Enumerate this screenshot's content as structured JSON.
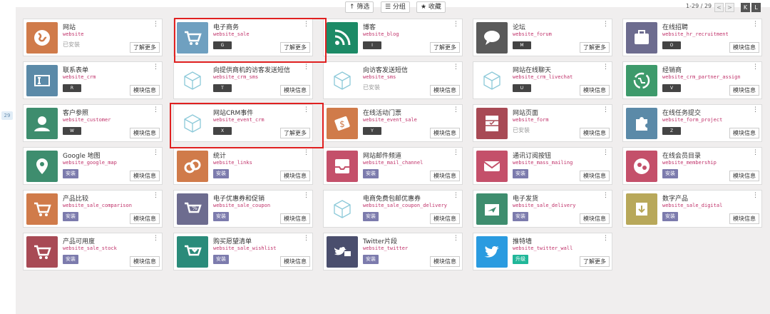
{
  "toolbar": {
    "filter_label": "↑ 筛选",
    "group_label": "☰ 分组",
    "fav_label": "★ 收藏",
    "pager": "1-29 / 29",
    "prev": "<",
    "next": ">"
  },
  "sidebar": {
    "count_badge": "29"
  },
  "cards": [
    {
      "title": "网站",
      "tech": "website",
      "status": "已安装",
      "action": "了解更多",
      "color": "#d07b4a",
      "icon": "globe-icon"
    },
    {
      "title": "电子商务",
      "tech": "website_sale",
      "key": "G",
      "action": "了解更多",
      "color": "#6fa0c0",
      "icon": "cart-icon"
    },
    {
      "title": "博客",
      "tech": "website_blog",
      "key": "I",
      "action": "了解更多",
      "color": "#1c8a66",
      "icon": "rss-icon"
    },
    {
      "title": "论坛",
      "tech": "website_forum",
      "key": "M",
      "action": "了解更多",
      "color": "#5a5a5a",
      "icon": "chat-icon"
    },
    {
      "title": "在线招聘",
      "tech": "website_hr_recruitment",
      "key": "O",
      "action": "模块信息",
      "color": "#6d6c8f",
      "icon": "briefcase-icon"
    },
    {
      "title": "联系表单",
      "tech": "website_crm",
      "key": "R",
      "action": "模块信息",
      "color": "#5b8aa8",
      "icon": "form-icon"
    },
    {
      "title": "向提供商机的访客发送短信",
      "tech": "website_crm_sms",
      "key": "T",
      "action": "模块信息",
      "color": "",
      "icon": "cube-icon"
    },
    {
      "title": "向访客发送短信",
      "tech": "website_sms",
      "status": "已安装",
      "action": "模块信息",
      "color": "",
      "icon": "cube-icon"
    },
    {
      "title": "网站在线聊天",
      "tech": "website_crm_livechat",
      "key": "U",
      "action": "模块信息",
      "color": "",
      "icon": "cube-icon"
    },
    {
      "title": "经销商",
      "tech": "website_crm_partner_assign",
      "key": "V",
      "action": "模块信息",
      "color": "#3d9a6b",
      "icon": "recycle-icon"
    },
    {
      "title": "客户参照",
      "tech": "website_customer",
      "key": "W",
      "action": "模块信息",
      "color": "#3e8d6e",
      "icon": "user-icon"
    },
    {
      "title": "网站CRM事件",
      "tech": "website_event_crm",
      "key": "X",
      "action": "了解更多",
      "color": "",
      "icon": "cube-icon"
    },
    {
      "title": "在线活动门票",
      "tech": "website_event_sale",
      "key": "Y",
      "action": "模块信息",
      "color": "#d07b4a",
      "icon": "ticket-icon"
    },
    {
      "title": "网站页面",
      "tech": "website_form",
      "status": "已安装",
      "action": "模块信息",
      "color": "#a84a55",
      "icon": "cabinet-icon"
    },
    {
      "title": "在线任务提交",
      "tech": "website_form_project",
      "key": "Z",
      "action": "模块信息",
      "color": "#5b8aa8",
      "icon": "puzzle-icon"
    },
    {
      "title": "Google 地图",
      "tech": "website_google_map",
      "install": "安装",
      "action": "模块信息",
      "color": "#3e8d6e",
      "icon": "map-pin-icon"
    },
    {
      "title": "统计",
      "tech": "website_links",
      "install": "安装",
      "action": "模块信息",
      "color": "#d07b4a",
      "icon": "link-icon"
    },
    {
      "title": "网站邮件频道",
      "tech": "website_mail_channel",
      "install": "安装",
      "action": "模块信息",
      "color": "#c4506a",
      "icon": "inbox-icon"
    },
    {
      "title": "通讯订阅按钮",
      "tech": "website_mass_mailing",
      "install": "安装",
      "action": "模块信息",
      "color": "#c4506a",
      "icon": "mail-icon"
    },
    {
      "title": "在线会员目录",
      "tech": "website_membership",
      "install": "安装",
      "action": "模块信息",
      "color": "#c4506a",
      "icon": "members-icon"
    },
    {
      "title": "产品比较",
      "tech": "website_sale_comparison",
      "install": "安装",
      "action": "模块信息",
      "color": "#d07b4a",
      "icon": "compare-cart-icon"
    },
    {
      "title": "电子优惠券和促销",
      "tech": "website_sale_coupon",
      "install": "安装",
      "action": "模块信息",
      "color": "#6d6c8f",
      "icon": "coupon-icon"
    },
    {
      "title": "电商免费包邮优惠券",
      "tech": "website_sale_coupon_delivery",
      "install": "安装",
      "action": "模块信息",
      "color": "",
      "icon": "cube-icon"
    },
    {
      "title": "电子发货",
      "tech": "website_sale_delivery",
      "install": "安装",
      "action": "模块信息",
      "color": "#3e8d6e",
      "icon": "plane-icon"
    },
    {
      "title": "数字产品",
      "tech": "website_sale_digital",
      "install": "安装",
      "action": "模块信息",
      "color": "#b8a85a",
      "icon": "download-icon"
    },
    {
      "title": "产品可用度",
      "tech": "website_sale_stock",
      "install": "安装",
      "action": "模块信息",
      "color": "#a84a55",
      "icon": "stock-cart-icon"
    },
    {
      "title": "购买愿望清单",
      "tech": "website_sale_wishlist",
      "install": "安装",
      "action": "模块信息",
      "color": "#2a8b7a",
      "icon": "heart-cart-icon"
    },
    {
      "title": "Twitter片段",
      "tech": "website_twitter",
      "install": "安装",
      "action": "模块信息",
      "color": "#4a4e6d",
      "icon": "twitter-snippet-icon"
    },
    {
      "title": "推特墙",
      "tech": "website_twitter_wall",
      "upgrade": "升级",
      "action": "了解更多",
      "color": "#2a9be0",
      "icon": "twitter-bird-icon"
    }
  ]
}
